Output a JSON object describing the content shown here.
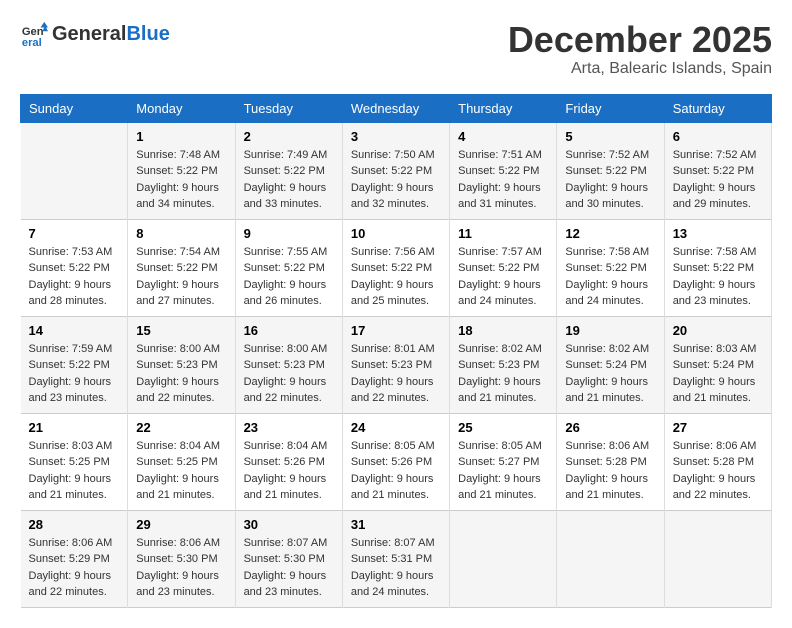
{
  "header": {
    "logo_line1": "General",
    "logo_line2": "Blue",
    "month_title": "December 2025",
    "location": "Arta, Balearic Islands, Spain"
  },
  "days_of_week": [
    "Sunday",
    "Monday",
    "Tuesday",
    "Wednesday",
    "Thursday",
    "Friday",
    "Saturday"
  ],
  "weeks": [
    [
      {
        "day": "",
        "info": ""
      },
      {
        "day": "1",
        "info": "Sunrise: 7:48 AM\nSunset: 5:22 PM\nDaylight: 9 hours\nand 34 minutes."
      },
      {
        "day": "2",
        "info": "Sunrise: 7:49 AM\nSunset: 5:22 PM\nDaylight: 9 hours\nand 33 minutes."
      },
      {
        "day": "3",
        "info": "Sunrise: 7:50 AM\nSunset: 5:22 PM\nDaylight: 9 hours\nand 32 minutes."
      },
      {
        "day": "4",
        "info": "Sunrise: 7:51 AM\nSunset: 5:22 PM\nDaylight: 9 hours\nand 31 minutes."
      },
      {
        "day": "5",
        "info": "Sunrise: 7:52 AM\nSunset: 5:22 PM\nDaylight: 9 hours\nand 30 minutes."
      },
      {
        "day": "6",
        "info": "Sunrise: 7:52 AM\nSunset: 5:22 PM\nDaylight: 9 hours\nand 29 minutes."
      }
    ],
    [
      {
        "day": "7",
        "info": "Sunrise: 7:53 AM\nSunset: 5:22 PM\nDaylight: 9 hours\nand 28 minutes."
      },
      {
        "day": "8",
        "info": "Sunrise: 7:54 AM\nSunset: 5:22 PM\nDaylight: 9 hours\nand 27 minutes."
      },
      {
        "day": "9",
        "info": "Sunrise: 7:55 AM\nSunset: 5:22 PM\nDaylight: 9 hours\nand 26 minutes."
      },
      {
        "day": "10",
        "info": "Sunrise: 7:56 AM\nSunset: 5:22 PM\nDaylight: 9 hours\nand 25 minutes."
      },
      {
        "day": "11",
        "info": "Sunrise: 7:57 AM\nSunset: 5:22 PM\nDaylight: 9 hours\nand 24 minutes."
      },
      {
        "day": "12",
        "info": "Sunrise: 7:58 AM\nSunset: 5:22 PM\nDaylight: 9 hours\nand 24 minutes."
      },
      {
        "day": "13",
        "info": "Sunrise: 7:58 AM\nSunset: 5:22 PM\nDaylight: 9 hours\nand 23 minutes."
      }
    ],
    [
      {
        "day": "14",
        "info": "Sunrise: 7:59 AM\nSunset: 5:22 PM\nDaylight: 9 hours\nand 23 minutes."
      },
      {
        "day": "15",
        "info": "Sunrise: 8:00 AM\nSunset: 5:23 PM\nDaylight: 9 hours\nand 22 minutes."
      },
      {
        "day": "16",
        "info": "Sunrise: 8:00 AM\nSunset: 5:23 PM\nDaylight: 9 hours\nand 22 minutes."
      },
      {
        "day": "17",
        "info": "Sunrise: 8:01 AM\nSunset: 5:23 PM\nDaylight: 9 hours\nand 22 minutes."
      },
      {
        "day": "18",
        "info": "Sunrise: 8:02 AM\nSunset: 5:23 PM\nDaylight: 9 hours\nand 21 minutes."
      },
      {
        "day": "19",
        "info": "Sunrise: 8:02 AM\nSunset: 5:24 PM\nDaylight: 9 hours\nand 21 minutes."
      },
      {
        "day": "20",
        "info": "Sunrise: 8:03 AM\nSunset: 5:24 PM\nDaylight: 9 hours\nand 21 minutes."
      }
    ],
    [
      {
        "day": "21",
        "info": "Sunrise: 8:03 AM\nSunset: 5:25 PM\nDaylight: 9 hours\nand 21 minutes."
      },
      {
        "day": "22",
        "info": "Sunrise: 8:04 AM\nSunset: 5:25 PM\nDaylight: 9 hours\nand 21 minutes."
      },
      {
        "day": "23",
        "info": "Sunrise: 8:04 AM\nSunset: 5:26 PM\nDaylight: 9 hours\nand 21 minutes."
      },
      {
        "day": "24",
        "info": "Sunrise: 8:05 AM\nSunset: 5:26 PM\nDaylight: 9 hours\nand 21 minutes."
      },
      {
        "day": "25",
        "info": "Sunrise: 8:05 AM\nSunset: 5:27 PM\nDaylight: 9 hours\nand 21 minutes."
      },
      {
        "day": "26",
        "info": "Sunrise: 8:06 AM\nSunset: 5:28 PM\nDaylight: 9 hours\nand 21 minutes."
      },
      {
        "day": "27",
        "info": "Sunrise: 8:06 AM\nSunset: 5:28 PM\nDaylight: 9 hours\nand 22 minutes."
      }
    ],
    [
      {
        "day": "28",
        "info": "Sunrise: 8:06 AM\nSunset: 5:29 PM\nDaylight: 9 hours\nand 22 minutes."
      },
      {
        "day": "29",
        "info": "Sunrise: 8:06 AM\nSunset: 5:30 PM\nDaylight: 9 hours\nand 23 minutes."
      },
      {
        "day": "30",
        "info": "Sunrise: 8:07 AM\nSunset: 5:30 PM\nDaylight: 9 hours\nand 23 minutes."
      },
      {
        "day": "31",
        "info": "Sunrise: 8:07 AM\nSunset: 5:31 PM\nDaylight: 9 hours\nand 24 minutes."
      },
      {
        "day": "",
        "info": ""
      },
      {
        "day": "",
        "info": ""
      },
      {
        "day": "",
        "info": ""
      }
    ]
  ]
}
